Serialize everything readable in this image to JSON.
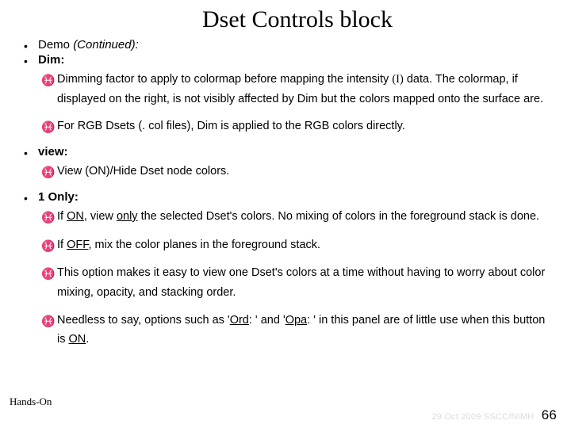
{
  "title": "Dset Controls block",
  "items": [
    {
      "label_pre": "Demo ",
      "label_ital": "(Continued):",
      "label_post": ""
    },
    {
      "label": "Dim:",
      "subs": [
        " Dimming factor to apply to colormap before mapping the intensity (I) data. The colormap, if displayed on the right, is not visibly affected by Dim but the colors mapped onto the surface are.",
        "For RGB Dsets (. col files), Dim is applied to the RGB colors directly."
      ]
    },
    {
      "label": "view:",
      "subs": [
        "View (ON)/Hide Dset node colors."
      ]
    },
    {
      "label": "1 Only:",
      "subs": [
        "If ON, view only the selected Dset's colors. No mixing of colors in the foreground stack is done.",
        "If OFF, mix the color planes in the foreground stack.",
        "This option makes it easy to view one Dset's colors at a time without having to worry about color mixing, opacity, and stacking order.",
        "Needless to say, options such as 'Ord: ' and 'Opa: ' in this panel are of little use when this button is ON."
      ]
    }
  ],
  "footer": {
    "left": "Hands-On",
    "right_date": "29 Oct 2009 SSCC/NIMH",
    "page": "66"
  }
}
